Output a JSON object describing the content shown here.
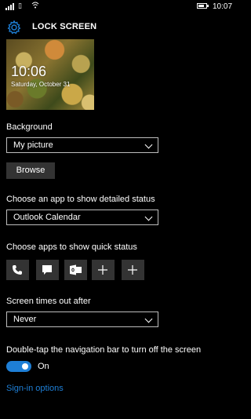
{
  "status_bar": {
    "icons": [
      "signal-icon",
      "sim-icon",
      "wifi-icon",
      "battery-icon"
    ],
    "time": "10:07"
  },
  "header": {
    "icon": "gear-icon",
    "title": "LOCK SCREEN",
    "accent_color": "#1e7fd6"
  },
  "preview": {
    "time": "10:06",
    "date": "Saturday, October 31"
  },
  "background": {
    "label": "Background",
    "selected": "My picture",
    "browse_label": "Browse"
  },
  "detailed_status": {
    "label": "Choose an app to show detailed status",
    "selected": "Outlook Calendar"
  },
  "quick_status": {
    "label": "Choose apps to show quick status",
    "slots": [
      "phone-icon",
      "message-icon",
      "outlook-mail-icon",
      "add-icon",
      "add-icon"
    ]
  },
  "timeout": {
    "label": "Screen times out after",
    "selected": "Never"
  },
  "double_tap": {
    "label": "Double-tap the navigation bar to turn off the screen",
    "state": "On",
    "enabled": true
  },
  "links": {
    "sign_in": "Sign-in options"
  }
}
